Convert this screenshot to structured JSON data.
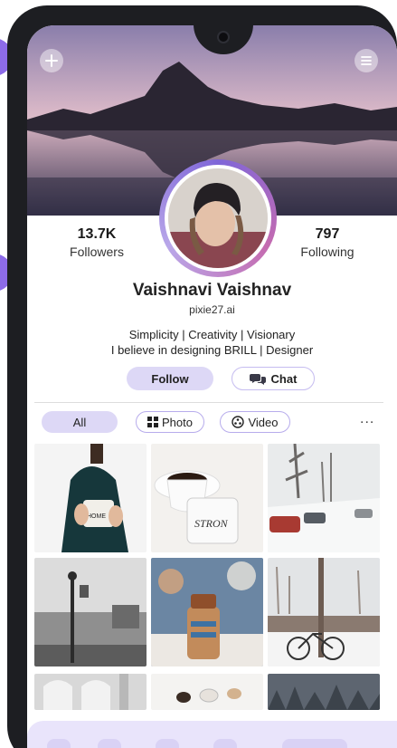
{
  "profile": {
    "name": "Vaishnavi Vaishnav",
    "handle": "pixie27.ai",
    "bio_line1": "Simplicity | Creativity | Visionary",
    "bio_line2": "I believe in designing BRILL | Designer"
  },
  "stats": {
    "followers_value": "13.7K",
    "followers_label": "Followers",
    "following_value": "797",
    "following_label": "Following"
  },
  "actions": {
    "follow_label": "Follow",
    "chat_label": "Chat"
  },
  "tabs": {
    "all_label": "All",
    "photo_label": "Photo",
    "video_label": "Video",
    "more_label": "..."
  },
  "colors": {
    "accent": "#8d6be8",
    "pill_fill": "#ddd8f6",
    "nav_bg": "#e9e4fb"
  },
  "icons": [
    "plus-icon",
    "menu-icon",
    "chat-icon",
    "grid-icon",
    "video-icon",
    "more-icon"
  ]
}
